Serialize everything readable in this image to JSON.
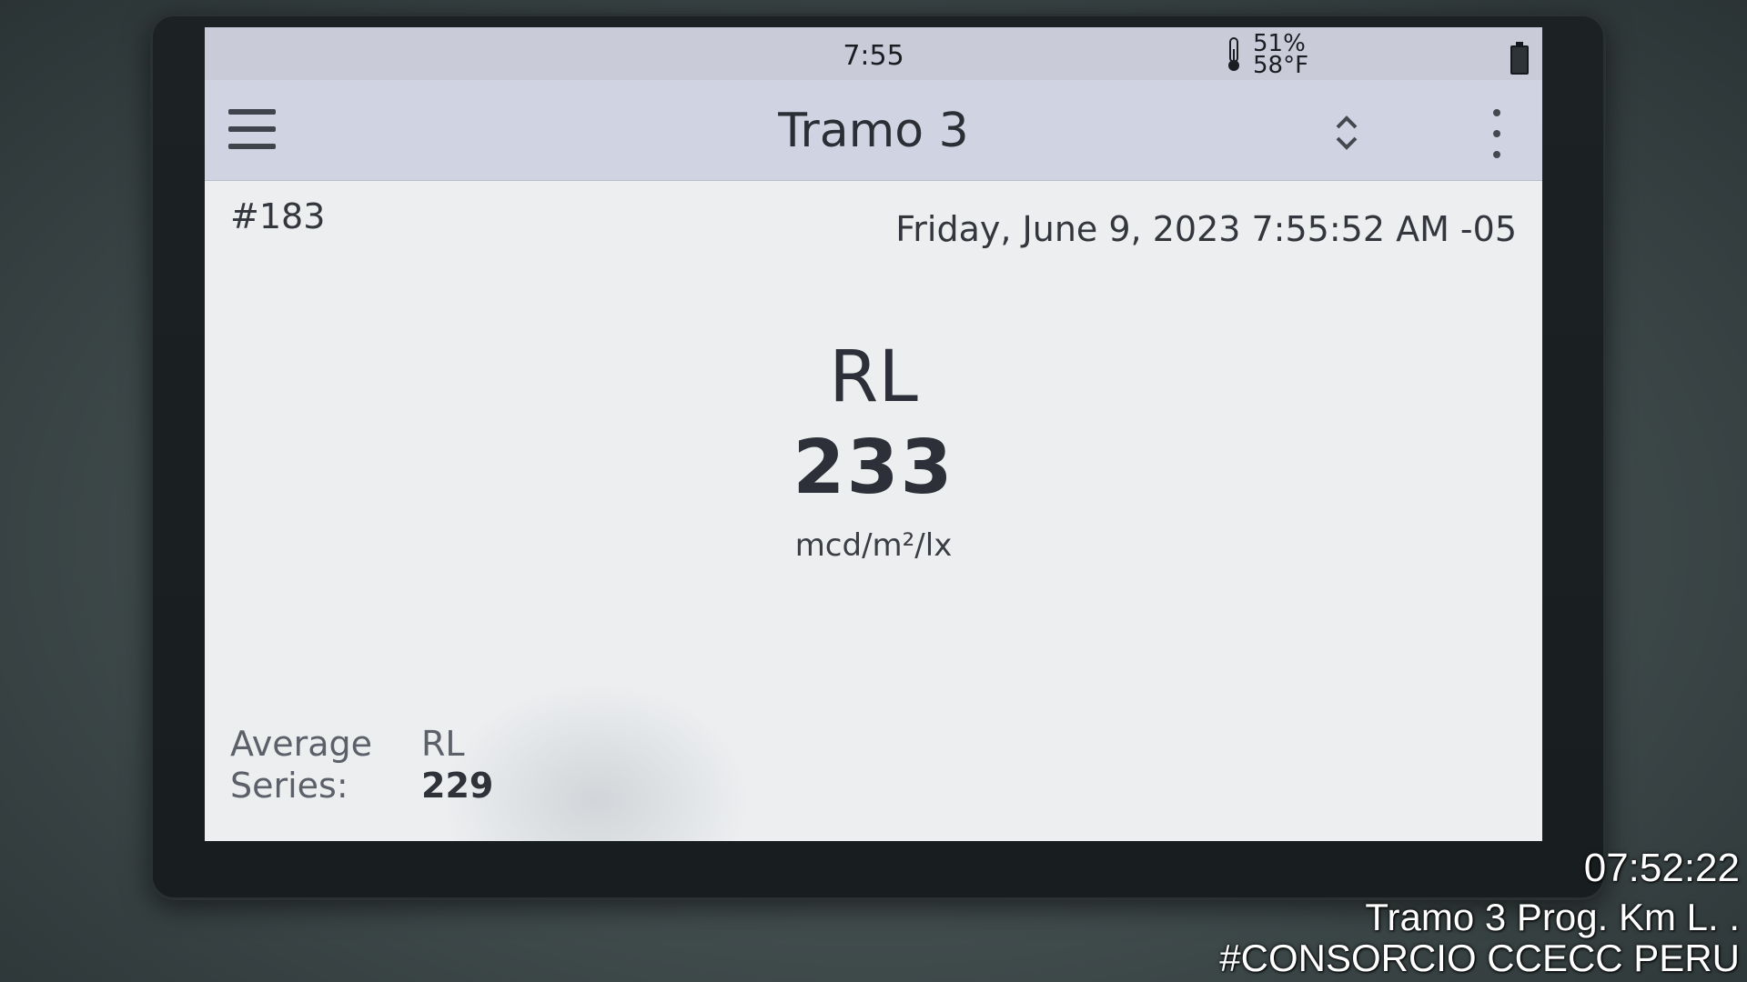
{
  "status_bar": {
    "time": "7:55",
    "humidity": "51%",
    "temperature": "58°F",
    "thermometer_icon": "thermometer-icon",
    "battery_icon": "battery-icon"
  },
  "app_bar": {
    "menu_icon": "hamburger-menu-icon",
    "title": "Tramo 3",
    "sort_icon": "up-down-chevron-icon",
    "more_icon": "vertical-ellipsis-icon"
  },
  "measurement": {
    "record_number": "#183",
    "datetime": "Friday, June 9, 2023 7:55:52 AM -05",
    "metric": "RL",
    "value": "233",
    "unit": "mcd/m²/lx"
  },
  "average": {
    "label_line1": "Average",
    "label_line2": "Series:",
    "metric": "RL",
    "value": "229"
  },
  "photo_overlay": {
    "time": "07:52:22",
    "location": "Tramo 3 Prog. Km        L.   .",
    "organization": "#CONSORCIO CCECC PERU"
  },
  "colors": {
    "screen_background": "#eceef0",
    "app_bar": "#d0d3e2",
    "device_bezel": "#1c2224"
  }
}
